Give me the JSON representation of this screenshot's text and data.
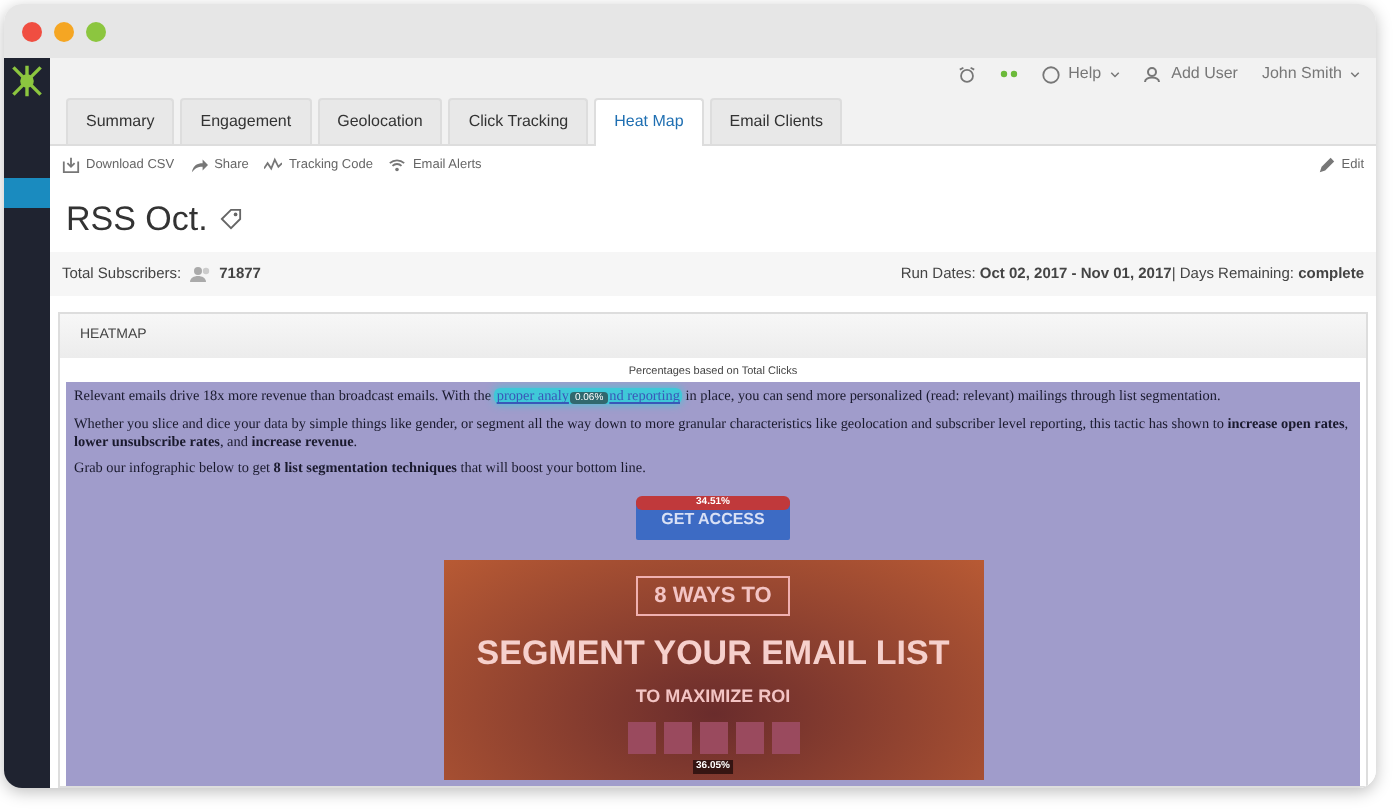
{
  "topbar": {
    "help": "Help",
    "add_user": "Add User",
    "user": "John Smith"
  },
  "tabs": [
    {
      "label": "Summary",
      "selected": false
    },
    {
      "label": "Engagement",
      "selected": false
    },
    {
      "label": "Geolocation",
      "selected": false
    },
    {
      "label": "Click Tracking",
      "selected": false
    },
    {
      "label": "Heat Map",
      "selected": true
    },
    {
      "label": "Email Clients",
      "selected": false
    }
  ],
  "toolbar": [
    {
      "label": "Download CSV",
      "kind": "download"
    },
    {
      "label": "Share",
      "kind": "share"
    },
    {
      "label": "Tracking Code",
      "kind": "code"
    },
    {
      "label": "Email Alerts",
      "kind": "alerts"
    }
  ],
  "edit": "Edit",
  "title": "RSS Oct.",
  "summary": {
    "subscribers_label": "Total Subscribers:",
    "subscribers": "71877",
    "run_dates": "Run Dates: **Oct 02, 2017 - Nov 01, 2017**| Days Remaining: **complete**"
  },
  "heatmap": {
    "title": "HEATMAP",
    "note": "Percentages based on Total Clicks",
    "intro": {
      "before": "Relevant emails drive 18x more revenue than broadcast emails. With the",
      "link_start": "proper analy",
      "link_pct": "0.06%",
      "link_end": "nd reporting",
      "after": "in place, you can send more personalized (read: relevant) mailings through list segmentation."
    },
    "paragraphs": [
      "Whether you slice and dice your data by simple things like gender, or segment all the way down to more granular characteristics like geolocation and subscriber level reporting, this tactic has shown to **increase open rates**, **lower unsubscribe rates**, and **increase revenue**.",
      "Grab our infographic below to get **8 list segmentation techniques** that will boost your bottom line."
    ],
    "button": {
      "label": "GET ACCESS",
      "pct": "34.51%"
    },
    "image": {
      "heading": "8 WAYS TO",
      "title": "SEGMENT YOUR EMAIL LIST",
      "subtitle": "TO MAXIMIZE ROI",
      "pct": "36.05%"
    }
  }
}
